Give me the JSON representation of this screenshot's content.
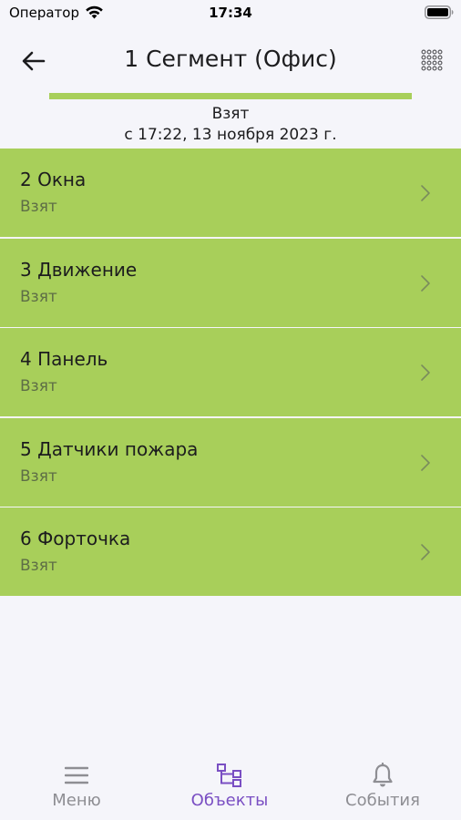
{
  "status_bar": {
    "carrier": "Оператор",
    "time": "17:34"
  },
  "nav": {
    "title": "1 Сегмент (Офис)",
    "back_icon": "arrow-left-icon",
    "grid_icon": "grid-dots-icon"
  },
  "segment_status": {
    "state": "Взят",
    "since": "с 17:22, 13 ноября 2023 г.",
    "color": "#a8cf5a"
  },
  "zones": [
    {
      "name": "2 Окна",
      "status": "Взят"
    },
    {
      "name": "3 Движение",
      "status": "Взят"
    },
    {
      "name": "4 Панель",
      "status": "Взят"
    },
    {
      "name": "5 Датчики пожара",
      "status": "Взят"
    },
    {
      "name": "6 Форточка",
      "status": "Взят"
    }
  ],
  "tab_bar": {
    "tabs": [
      {
        "label": "Меню",
        "icon": "menu-icon",
        "active": false
      },
      {
        "label": "Объекты",
        "icon": "objects-tree-icon",
        "active": true
      },
      {
        "label": "События",
        "icon": "bell-icon",
        "active": false
      }
    ],
    "active_color": "#7a4fc3",
    "inactive_color": "#8e8e93"
  }
}
